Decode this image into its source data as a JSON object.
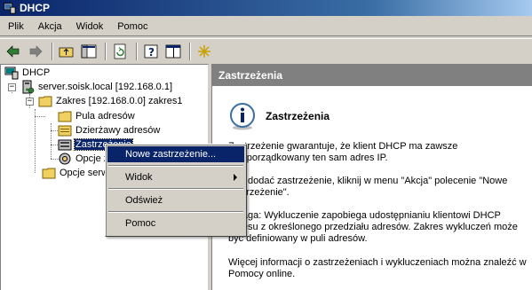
{
  "window": {
    "title": "DHCP"
  },
  "menubar": {
    "items": [
      {
        "label": "Plik"
      },
      {
        "label": "Akcja"
      },
      {
        "label": "Widok"
      },
      {
        "label": "Pomoc"
      }
    ]
  },
  "toolbar": {
    "icons": [
      "back-icon",
      "forward-icon",
      "up-folder-icon",
      "show-hide-tree-icon",
      "refresh-icon",
      "properties-icon",
      "help-icon",
      "new-item-icon"
    ]
  },
  "tree": {
    "root": "DHCP",
    "server": "server.soisk.local [192.168.0.1]",
    "scope": "Zakres [192.168.0.0] zakres1",
    "children": [
      "Pula adresów",
      "Dzierżawy adresów",
      "Zastrzeżenia",
      "Opcje zakresu"
    ],
    "server_options": "Opcje serwera"
  },
  "right_pane": {
    "header": "Zastrzeżenia",
    "title": "Zastrzeżenia",
    "para1": "Zastrzeżenie gwarantuje, że klient DHCP ma zawsze przyporządkowany ten sam adres IP.",
    "para2": "Aby dodać zastrzeżenie, kliknij w menu \"Akcja\" polecenie \"Nowe zastrzeżenie\".",
    "para3": "Uwaga: Wykluczenie zapobiega udostępnianiu klientowi DHCP adresu z określonego przedziału adresów. Zakres wykluczeń może być definiowany w puli adresów.",
    "para4": "Więcej informacji o zastrzeżeniach i wykluczeniach można znaleźć w Pomocy online."
  },
  "context_menu": {
    "items": [
      {
        "label": "Nowe zastrzeżenie..."
      },
      {
        "label": "Widok"
      },
      {
        "label": "Odśwież"
      },
      {
        "label": "Pomoc"
      }
    ]
  },
  "colors": {
    "title_active": "#0a246a",
    "selection": "#0a246a",
    "face": "#d4d0c8"
  }
}
